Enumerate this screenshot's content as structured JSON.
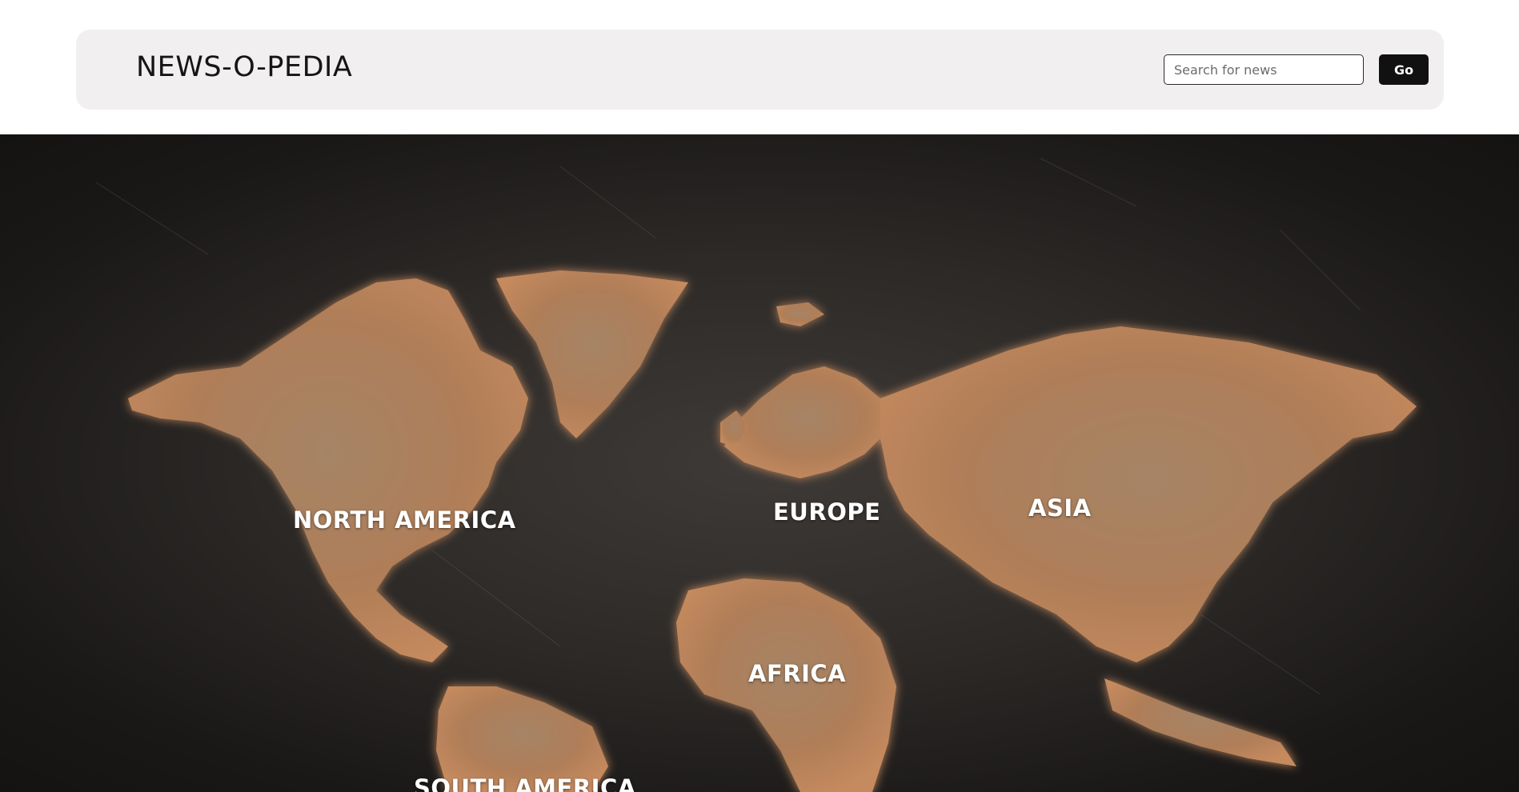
{
  "header": {
    "brand": "NEWS-O-PEDIA",
    "search_placeholder": "Search for news",
    "search_value": "",
    "go_label": "Go"
  },
  "map": {
    "continents": [
      {
        "id": "north-america",
        "label": "NORTH AMERICA"
      },
      {
        "id": "europe",
        "label": "EUROPE"
      },
      {
        "id": "asia",
        "label": "ASIA"
      },
      {
        "id": "africa",
        "label": "AFRICA"
      },
      {
        "id": "south-america",
        "label": "SOUTH AMERICA"
      }
    ]
  },
  "colors": {
    "navbar_bg": "#f1eff0",
    "button_bg": "#111111",
    "map_bg": "#2c2927",
    "land": "#b9865e"
  }
}
